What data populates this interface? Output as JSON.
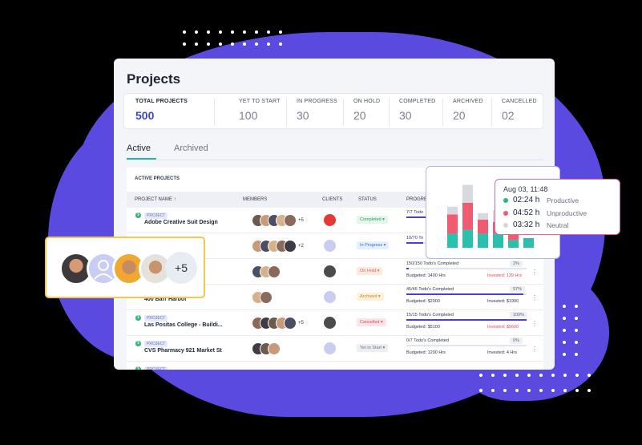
{
  "colors": {
    "background": "#000000",
    "accent_purple": "#5b4ae0",
    "teal": "#27b3a3",
    "productive": "#2bbfae",
    "unproductive": "#f05b72",
    "neutral": "#d8d9df",
    "highlight_border": "#f2c94c"
  },
  "page": {
    "title": "Projects"
  },
  "stats": [
    {
      "label": "TOTAL PROJECTS",
      "value": "500"
    },
    {
      "label": "YET TO START",
      "value": "100"
    },
    {
      "label": "IN PROGRESS",
      "value": "30"
    },
    {
      "label": "ON HOLD",
      "value": "20"
    },
    {
      "label": "COMPLETED",
      "value": "30"
    },
    {
      "label": "ARCHIVED",
      "value": "20"
    },
    {
      "label": "CANCELLED",
      "value": "02"
    }
  ],
  "tabs": [
    {
      "label": "Active"
    },
    {
      "label": "Archived"
    }
  ],
  "table": {
    "caption": "ACTIVE PROJECTS",
    "headers": {
      "project_name": "PROJECT NAME ↑",
      "members": "MEMBERS",
      "clients": "CLIENTS",
      "status": "STATUS",
      "progress": "PROGRE"
    },
    "rows": [
      {
        "tag": "PROJECT",
        "name": "Adobe Creative Suit Design",
        "members_more": "+5",
        "status": "Completed ▾",
        "status_kind": "completed",
        "progress_text": "7/7 Todo",
        "budget": "",
        "invested": "",
        "pct": "",
        "progress": 1.0
      },
      {
        "tag": "",
        "name": "",
        "members_more": "+2",
        "status": "In Progress ▾",
        "status_kind": "inprogress",
        "progress_text": "10/70 To",
        "budget": "",
        "invested": "",
        "pct": "",
        "progress": 0.14
      },
      {
        "tag": "",
        "name": "u. Ren...",
        "members_more": "",
        "status": "On Hold ▾",
        "status_kind": "onhold",
        "progress_text": "150/150 Todo's Completed",
        "budget": "Budgeted: 1400 Hrs",
        "invested": "Invested: 139 Hrs",
        "pct": "2%",
        "progress": 0.02
      },
      {
        "tag": "",
        "name": "400 Barr Harbor",
        "members_more": "",
        "status": "Archived ▾",
        "status_kind": "archived",
        "progress_text": "45/46 Todo's Completed",
        "budget": "Budgeted: $2000",
        "invested": "Invested: $1900",
        "pct": "97%",
        "progress": 0.97
      },
      {
        "tag": "PROJECT",
        "name": "Las Positas College - Buildi...",
        "members_more": "+5",
        "status": "Cancelled ▾",
        "status_kind": "cancelled",
        "progress_text": "15/15 Todo's Completed",
        "budget": "Budgeted: $5100",
        "invested": "Invested: $5600",
        "pct": "100%",
        "progress": 1.0
      },
      {
        "tag": "PROJECT",
        "name": "CVS Pharmacy 921 Market St",
        "members_more": "",
        "status": "Yet to Start ▾",
        "status_kind": "yettostart",
        "progress_text": "0/7 Todo's Completed",
        "budget": "Budgeted: 1200 Hrs",
        "invested": "Invested: 4 Hrs",
        "pct": "0%",
        "progress": 0.0
      },
      {
        "tag": "PROJECT",
        "name": "",
        "members_more": "",
        "status": "",
        "status_kind": "",
        "progress_text": "",
        "budget": "",
        "invested": "",
        "pct": "",
        "progress": 0
      }
    ]
  },
  "member_card": {
    "more": "+5"
  },
  "chart_data": {
    "type": "bar",
    "stacked": true,
    "categories": [
      "1",
      "2",
      "3",
      "4",
      "5",
      "6"
    ],
    "series": [
      {
        "name": "Productive",
        "values": [
          0.22,
          0.28,
          0.22,
          0.22,
          0.12,
          0.15
        ]
      },
      {
        "name": "Unproductive",
        "values": [
          0.3,
          0.42,
          0.22,
          0.18,
          0.22,
          0.0
        ]
      },
      {
        "name": "Neutral",
        "values": [
          0.12,
          0.28,
          0.1,
          0.18,
          0.2,
          0.0
        ]
      }
    ],
    "ylim": [
      0,
      1
    ]
  },
  "tooltip": {
    "date": "Aug 03, 11:48",
    "items": [
      {
        "value": "02:24 h",
        "label": "Productive"
      },
      {
        "value": "04:52 h",
        "label": "Unproductive"
      },
      {
        "value": "03:32 h",
        "label": "Neutral"
      }
    ]
  }
}
